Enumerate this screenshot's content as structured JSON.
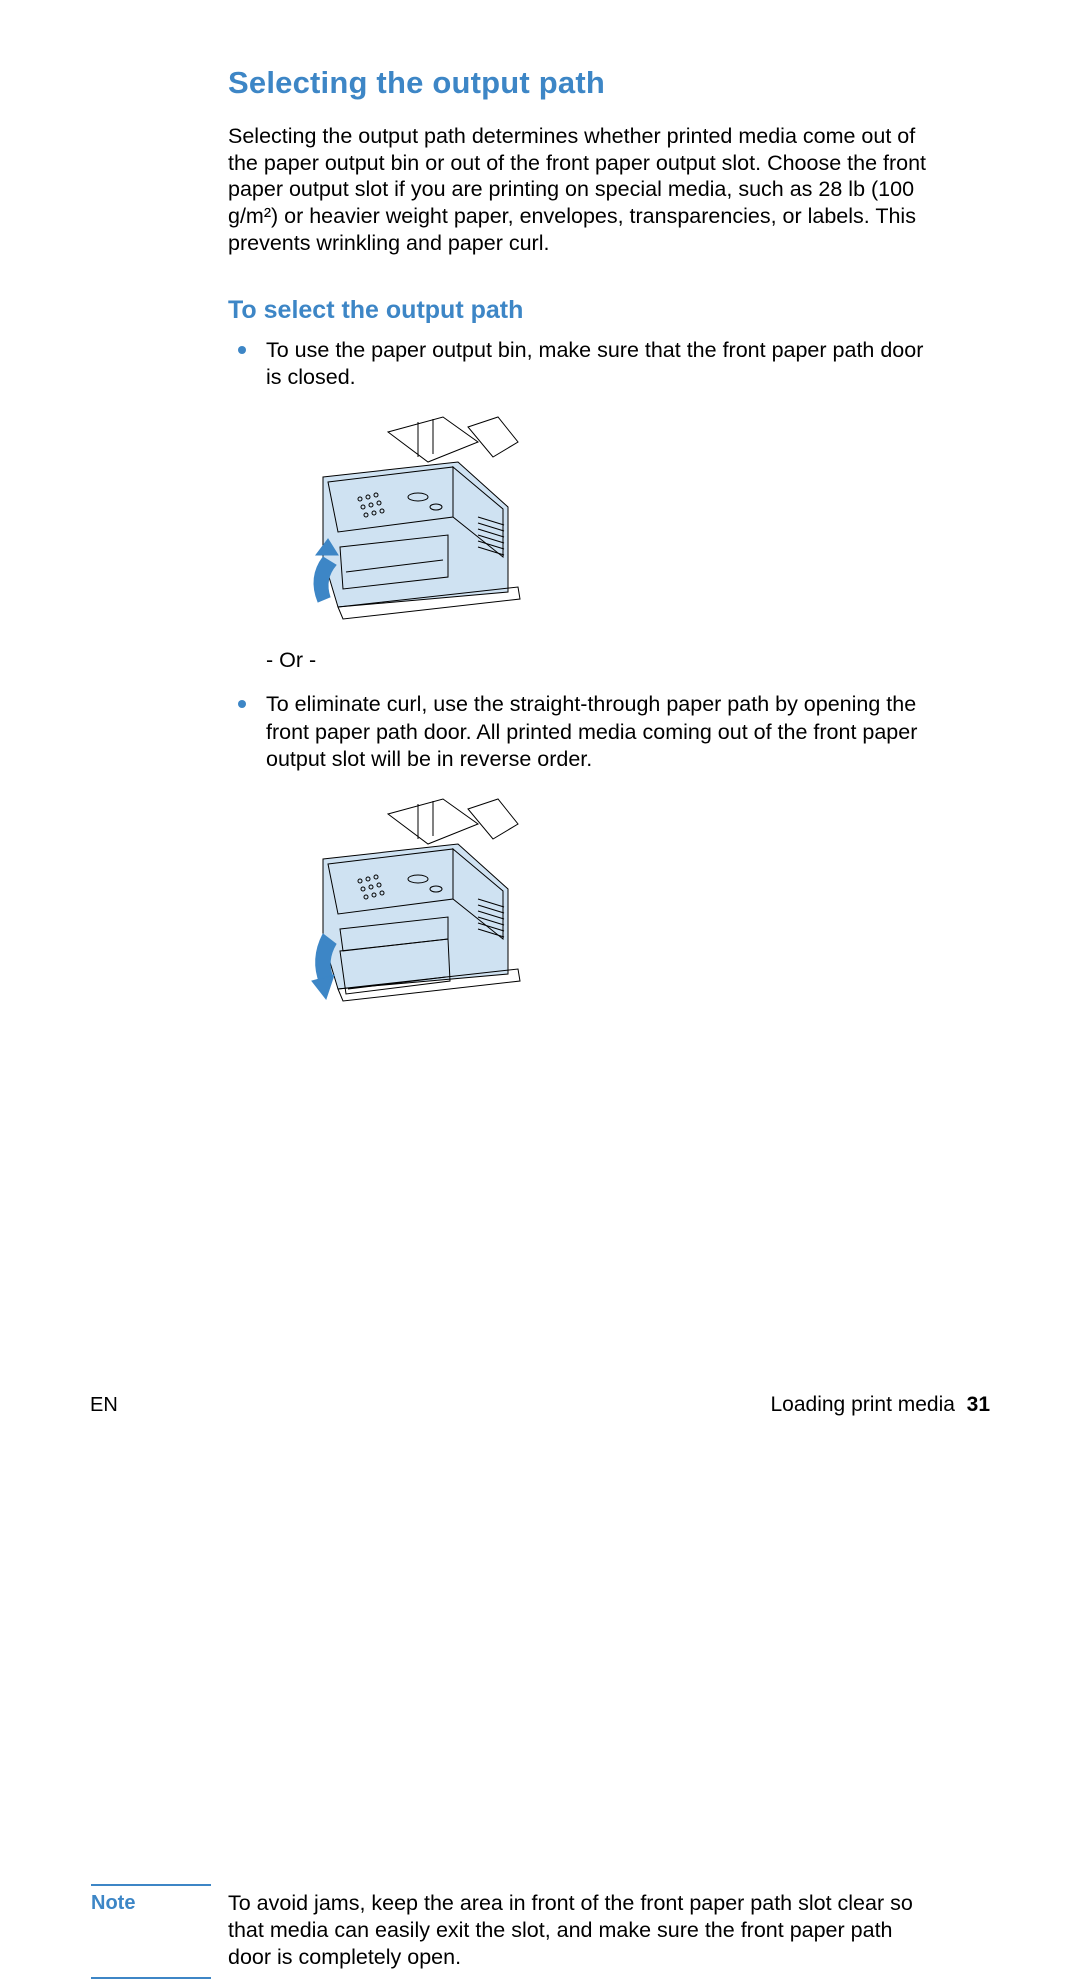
{
  "heading": "Selecting the output path",
  "intro": "Selecting the output path determines whether printed media come out of the paper output bin or out of the front paper output slot. Choose the front paper output slot if you are printing on special media, such as 28 lb (100 g/m²) or heavier weight paper, envelopes, transparencies, or labels. This prevents wrinkling and paper curl.",
  "subheading": "To select the output path",
  "bullets": {
    "b1": "To use the paper output bin, make sure that the front paper path door is closed.",
    "or": "- Or -",
    "b2": "To eliminate curl, use the straight-through paper path by opening the front paper path door. All printed media coming out of the front paper output slot will be in reverse order."
  },
  "note": {
    "label": "Note",
    "text": "To avoid jams, keep the area in front of the front paper path slot clear so that media can easily exit the slot, and make sure the front paper path door is completely open."
  },
  "footer": {
    "left": "EN",
    "section": "Loading print media",
    "page": "31"
  },
  "illustrations": {
    "fig1": "printer-door-closed-illustration",
    "fig2": "printer-door-open-illustration"
  }
}
